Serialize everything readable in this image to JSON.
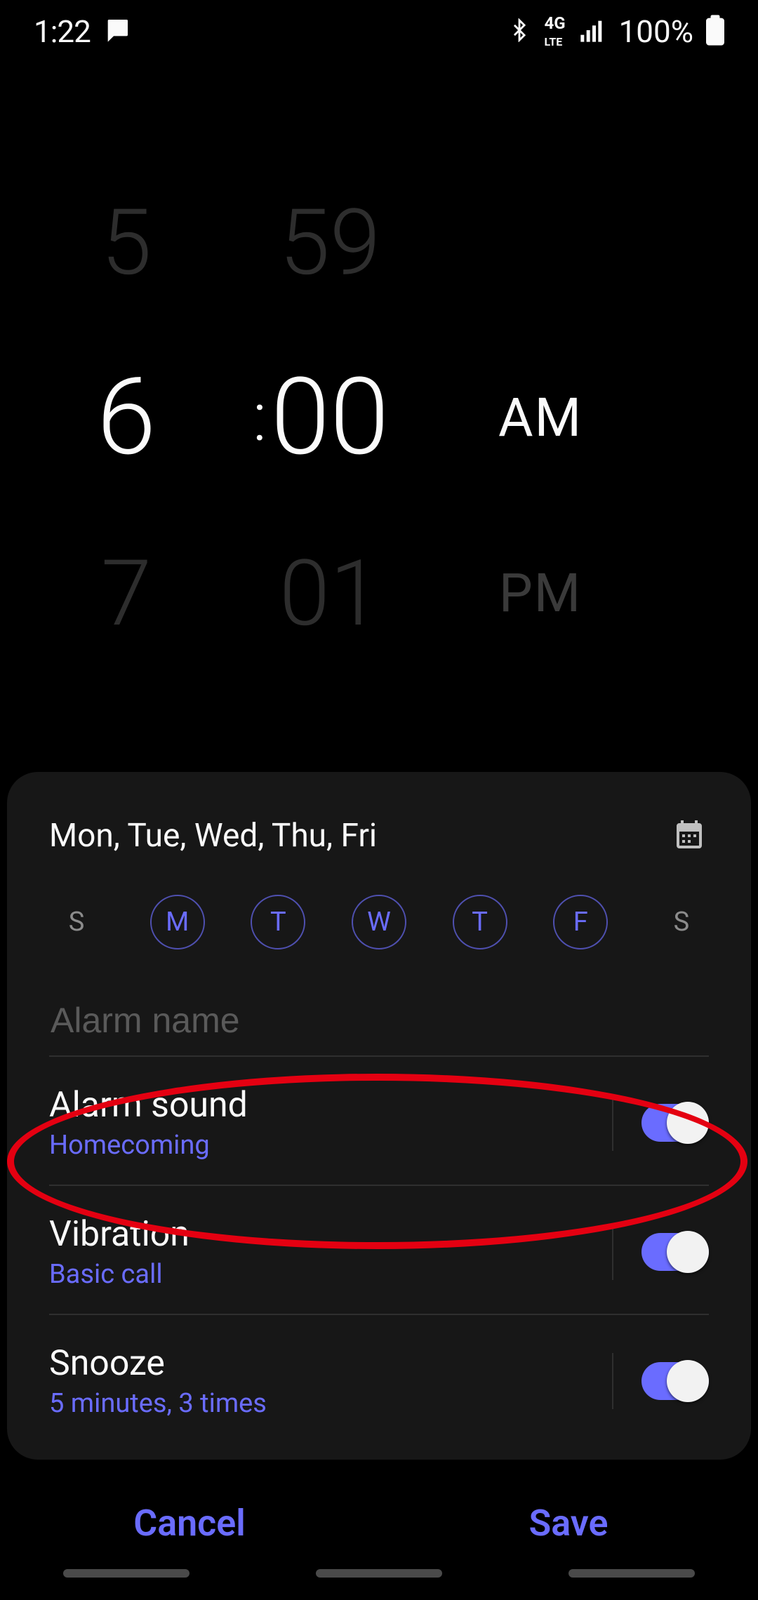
{
  "status": {
    "time": "1:22",
    "battery_text": "100%"
  },
  "time_picker": {
    "hour_prev": "5",
    "hour": "6",
    "hour_next": "7",
    "colon": ":",
    "minute_prev": "59",
    "minute": "00",
    "minute_next": "01",
    "ampm": "AM",
    "ampm_alt": "PM"
  },
  "days": {
    "summary": "Mon, Tue, Wed, Thu, Fri",
    "labels": [
      "S",
      "M",
      "T",
      "W",
      "T",
      "F",
      "S"
    ],
    "selected": [
      false,
      true,
      true,
      true,
      true,
      true,
      false
    ]
  },
  "alarm_name": {
    "placeholder": "Alarm name",
    "value": ""
  },
  "options": {
    "sound": {
      "title": "Alarm sound",
      "sub": "Homecoming",
      "on": true
    },
    "vibration": {
      "title": "Vibration",
      "sub": "Basic call",
      "on": true
    },
    "snooze": {
      "title": "Snooze",
      "sub": "5 minutes, 3 times",
      "on": true
    }
  },
  "footer": {
    "cancel": "Cancel",
    "save": "Save"
  }
}
